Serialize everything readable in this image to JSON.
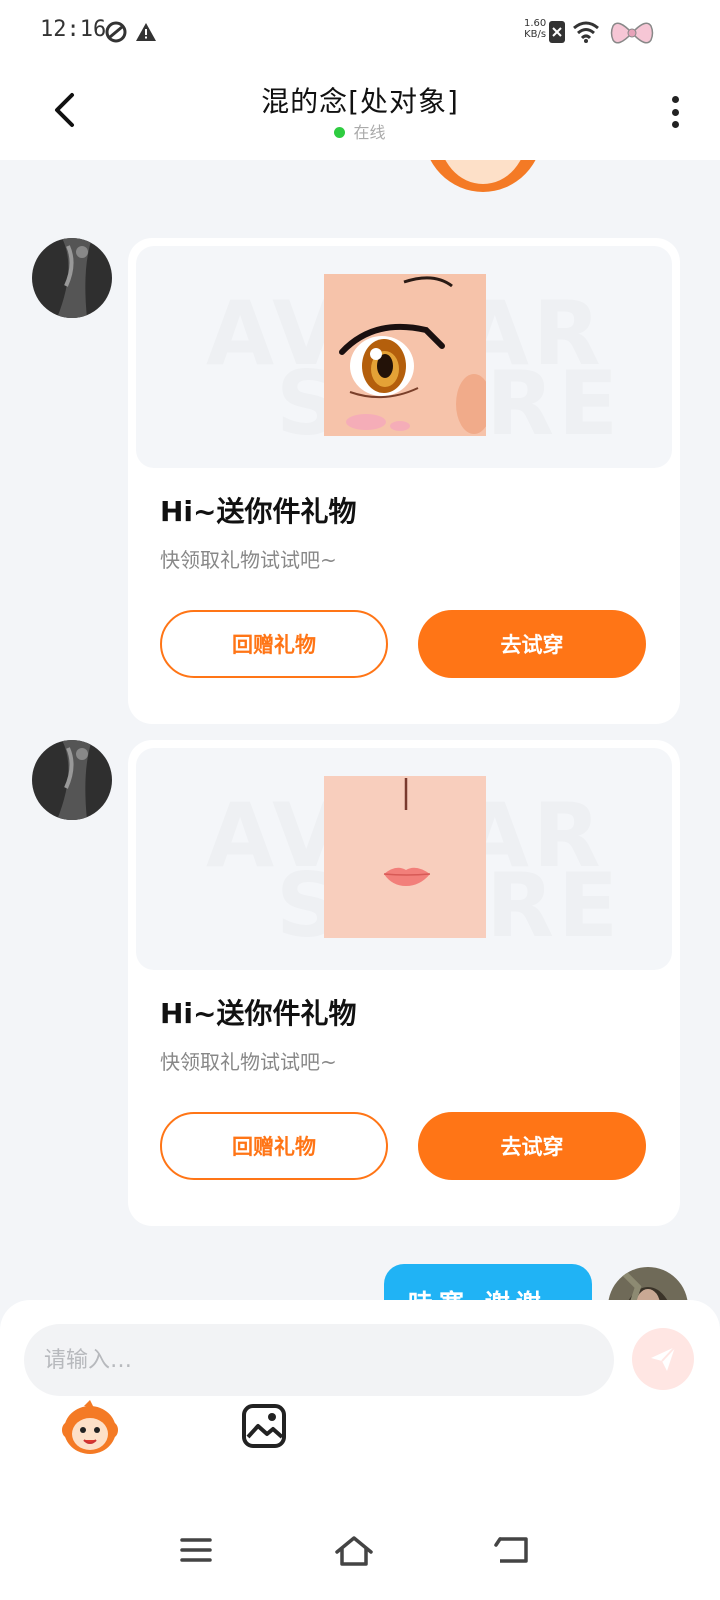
{
  "status_bar": {
    "time": "12:16",
    "net_speed_value": "1.60",
    "net_speed_unit": "KB/s"
  },
  "header": {
    "title": "混的念[处对象]",
    "status": "在线"
  },
  "messages": [
    {
      "title": "Hi~送你件礼物",
      "subtitle": "快领取礼物试试吧~",
      "button_gift_back": "回赠礼物",
      "button_try_on": "去试穿",
      "watermark_top": "AVATAR",
      "watermark_bottom": "STORE"
    },
    {
      "title": "Hi~送你件礼物",
      "subtitle": "快领取礼物试试吧~",
      "button_gift_back": "回赠礼物",
      "button_try_on": "去试穿",
      "watermark_top": "AVATAR",
      "watermark_bottom": "STORE"
    }
  ],
  "my_message": {
    "text": "哇塞 谢谢"
  },
  "composer": {
    "placeholder": "请输入…"
  },
  "colors": {
    "accent": "#ff7516",
    "my_bubble": "#20b3f5",
    "online": "#2ecc40",
    "background": "#f3f5f8"
  }
}
